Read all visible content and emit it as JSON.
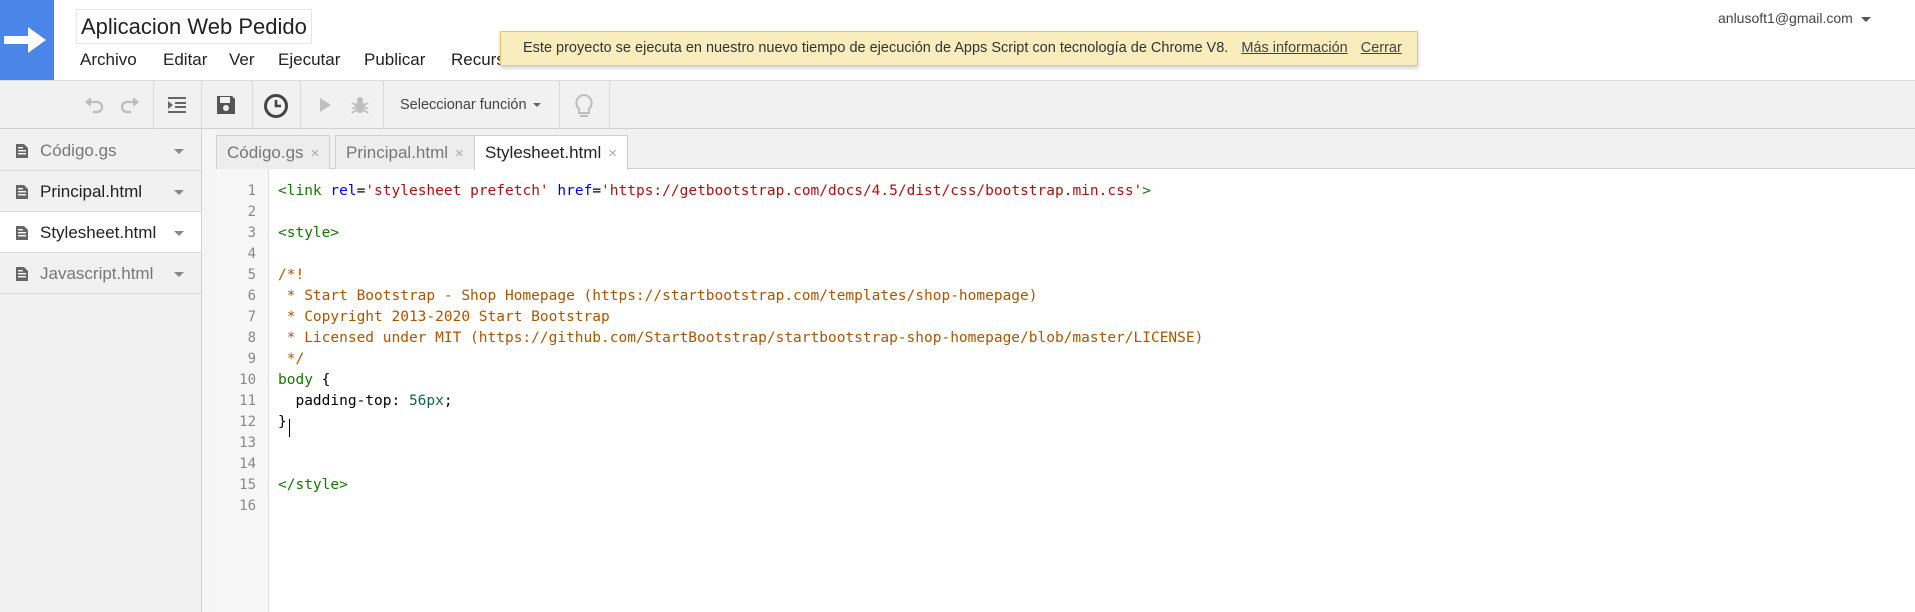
{
  "header": {
    "project_title": "Aplicacion Web Pedido",
    "menu": [
      "Archivo",
      "Editar",
      "Ver",
      "Ejecutar",
      "Publicar",
      "Recursos"
    ],
    "account_email": "anlusoft1@gmail.com",
    "logo_color": "#4a86e8"
  },
  "notice": {
    "message": "Este proyecto se ejecuta en nuestro nuevo tiempo de ejecución de Apps Script con tecnología de Chrome V8.",
    "more_info": "Más información",
    "close": "Cerrar",
    "background": "#f9edbe"
  },
  "toolbar": {
    "undo_icon": "undo-icon",
    "redo_icon": "redo-icon",
    "indent_icon": "indent-icon",
    "save_icon": "save-icon",
    "triggers_icon": "clock-icon",
    "run_icon": "play-icon",
    "debug_icon": "bug-icon",
    "select_function": "Seleccionar función",
    "hint_icon": "lightbulb-icon"
  },
  "files": [
    {
      "name": "Código.gs",
      "bold": false,
      "active": false
    },
    {
      "name": "Principal.html",
      "bold": true,
      "active": false
    },
    {
      "name": "Stylesheet.html",
      "bold": true,
      "active": true
    },
    {
      "name": "Javascript.html",
      "bold": false,
      "active": false
    }
  ],
  "tabs": [
    {
      "label": "Código.gs",
      "active": false
    },
    {
      "label": "Principal.html",
      "active": false
    },
    {
      "label": "Stylesheet.html",
      "active": true
    }
  ],
  "tab_close_glyph": "×",
  "code": {
    "line_numbers": [
      "1",
      "2",
      "3",
      "4",
      "5",
      "6",
      "7",
      "8",
      "9",
      "10",
      "11",
      "12",
      "13",
      "14",
      "15",
      "16"
    ],
    "lines": [
      [
        [
          "c-tag",
          "<link"
        ],
        [
          "",
          "",
          " "
        ],
        [
          "c-attr",
          "rel"
        ],
        [
          "",
          "="
        ],
        [
          "c-str",
          "'stylesheet prefetch'"
        ],
        [
          "",
          " "
        ],
        [
          "c-attr",
          "href"
        ],
        [
          "",
          "="
        ],
        [
          "c-str",
          "'https://getbootstrap.com/docs/4.5/dist/css/bootstrap.min.css'"
        ],
        [
          "c-tag",
          ">"
        ]
      ],
      [],
      [
        [
          "c-tag",
          "<style>"
        ]
      ],
      [],
      [
        [
          "c-cmt",
          "/*!"
        ]
      ],
      [
        [
          "c-cmt",
          " * Start Bootstrap - Shop Homepage (https://startbootstrap.com/templates/shop-homepage)"
        ]
      ],
      [
        [
          "c-cmt",
          " * Copyright 2013-2020 Start Bootstrap"
        ]
      ],
      [
        [
          "c-cmt",
          " * Licensed under MIT (https://github.com/StartBootstrap/startbootstrap-shop-homepage/blob/master/LICENSE)"
        ]
      ],
      [
        [
          "c-cmt",
          " */"
        ]
      ],
      [
        [
          "c-kw",
          "body"
        ],
        [
          "",
          " {"
        ]
      ],
      [
        [
          "",
          "  padding-top: "
        ],
        [
          "c-num",
          "56px"
        ],
        [
          "",
          ";"
        ]
      ],
      [
        [
          "",
          "}"
        ]
      ],
      [],
      [],
      [
        [
          "c-tag",
          "</style>"
        ]
      ],
      []
    ]
  }
}
